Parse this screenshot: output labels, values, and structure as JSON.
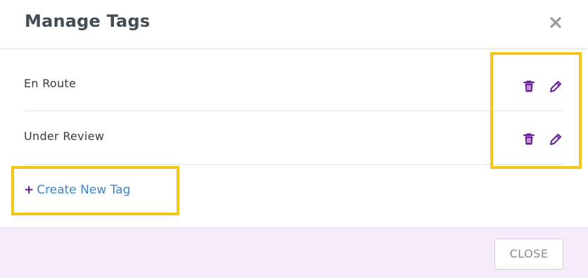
{
  "modal": {
    "title": "Manage Tags",
    "close_icon": "close-x-icon"
  },
  "tags": [
    {
      "name": "En Route",
      "delete_icon": "trash-icon",
      "edit_icon": "pencil-icon"
    },
    {
      "name": "Under Review",
      "delete_icon": "trash-icon",
      "edit_icon": "pencil-icon"
    }
  ],
  "create_link": {
    "plus": "+",
    "label": "Create New Tag"
  },
  "footer": {
    "close_label": "CLOSE"
  },
  "colors": {
    "accent_purple": "#5b1a8b",
    "link_blue": "#3d86c6",
    "highlight_yellow": "#f5c518",
    "footer_bg": "#f6ebfb"
  }
}
